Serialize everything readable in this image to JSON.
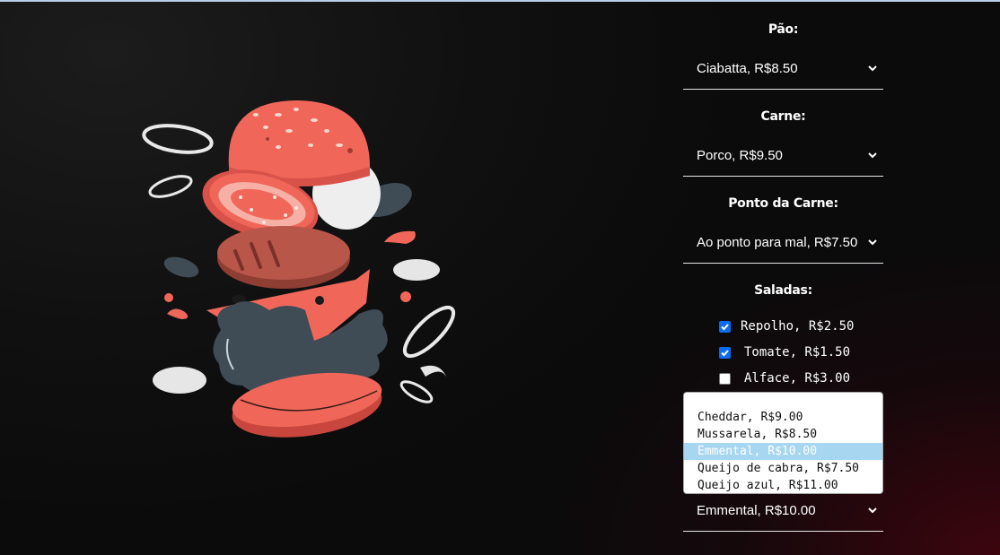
{
  "form": {
    "pao": {
      "label": "Pão:",
      "value": "Ciabatta, R$8.50"
    },
    "carne": {
      "label": "Carne:",
      "value": "Porco, R$9.50"
    },
    "ponto": {
      "label": "Ponto da Carne:",
      "value": "Ao ponto para mal, R$7.50"
    },
    "saladas": {
      "label": "Saladas:",
      "items": [
        {
          "label": "Repolho, R$2.50",
          "checked": true
        },
        {
          "label": "Tomate, R$1.50",
          "checked": true
        },
        {
          "label": "Alface, R$3.00",
          "checked": false
        }
      ]
    },
    "queijo": {
      "value": "Emmental, R$10.00",
      "options": [
        "Cheddar, R$9.00",
        "Mussarela, R$8.50",
        "Emmental, R$10.00",
        "Queijo de cabra, R$7.50",
        "Queijo azul, R$11.00"
      ],
      "selected_index": 2
    }
  },
  "colors": {
    "accent": "#0b6cf0",
    "highlight": "#a7d6f1",
    "burger_red": "#f0675a",
    "burger_dark": "#3f4b55"
  },
  "icons": {
    "illustration": "burger-illustration",
    "chevron": "chevron-down-icon",
    "check": "checkmark-icon"
  }
}
